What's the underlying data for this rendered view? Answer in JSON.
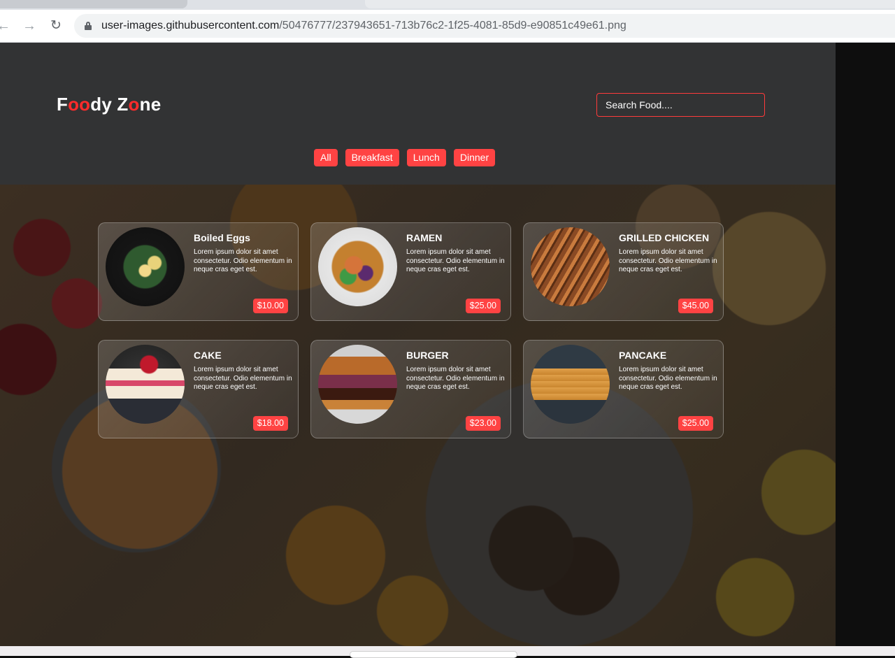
{
  "browser": {
    "url_host": "user-images.githubusercontent.com",
    "url_path": "/50476777/237943651-713b76c2-1f25-4081-85d9-e90851c49e61.png",
    "back_icon": "←",
    "forward_icon": "→",
    "reload_icon": "C"
  },
  "header": {
    "logo_parts": [
      "F",
      "oo",
      "dy Z",
      "o",
      "ne"
    ],
    "search_placeholder": "Search Food....",
    "accent_color": "#ff4343"
  },
  "filters": [
    "All",
    "Breakfast",
    "Lunch",
    "Dinner"
  ],
  "foods": [
    {
      "name": "Boiled Eggs",
      "description": "Lorem ipsum dolor sit amet consectetur. Odio elementum in neque cras eget est.",
      "price": "$10.00"
    },
    {
      "name": "RAMEN",
      "description": "Lorem ipsum dolor sit amet consectetur. Odio elementum in neque cras eget est.",
      "price": "$25.00"
    },
    {
      "name": "GRILLED CHICKEN",
      "description": "Lorem ipsum dolor sit amet consectetur. Odio elementum in neque cras eget est.",
      "price": "$45.00"
    },
    {
      "name": "CAKE",
      "description": "Lorem ipsum dolor sit amet consectetur. Odio elementum in neque cras eget est.",
      "price": "$18.00"
    },
    {
      "name": "BURGER",
      "description": "Lorem ipsum dolor sit amet consectetur. Odio elementum in neque cras eget est.",
      "price": "$23.00"
    },
    {
      "name": "PANCAKE",
      "description": "Lorem ipsum dolor sit amet consectetur. Odio elementum in neque cras eget est.",
      "price": "$25.00"
    }
  ]
}
